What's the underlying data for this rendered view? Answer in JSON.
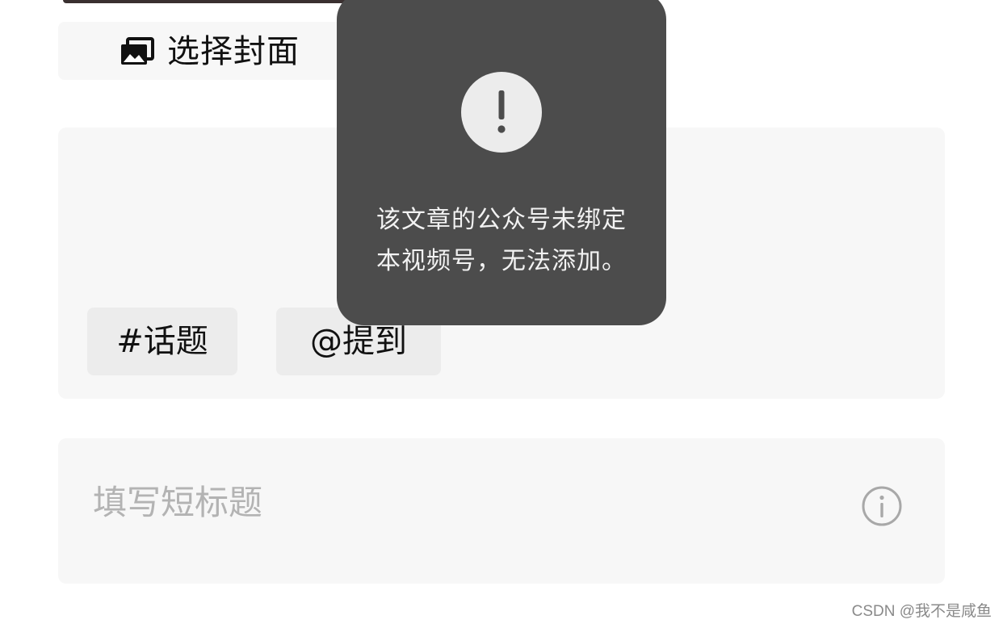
{
  "cover": {
    "icon": "image-gallery-icon",
    "label": "选择封面"
  },
  "description": {
    "chips": {
      "topic": "#话题",
      "mention": "@提到"
    }
  },
  "short_title": {
    "placeholder": "填写短标题",
    "info_icon": "info-icon"
  },
  "toast": {
    "icon": "exclamation-icon",
    "line1": "该文章的公众号未绑定",
    "line2": "本视频号，无法添加。"
  },
  "watermark": "CSDN @我不是咸鱼",
  "colors": {
    "toast_bg": "#4c4c4c",
    "field_bg": "#f7f7f7",
    "chip_bg": "#ececec",
    "placeholder": "#b3b3b3"
  }
}
